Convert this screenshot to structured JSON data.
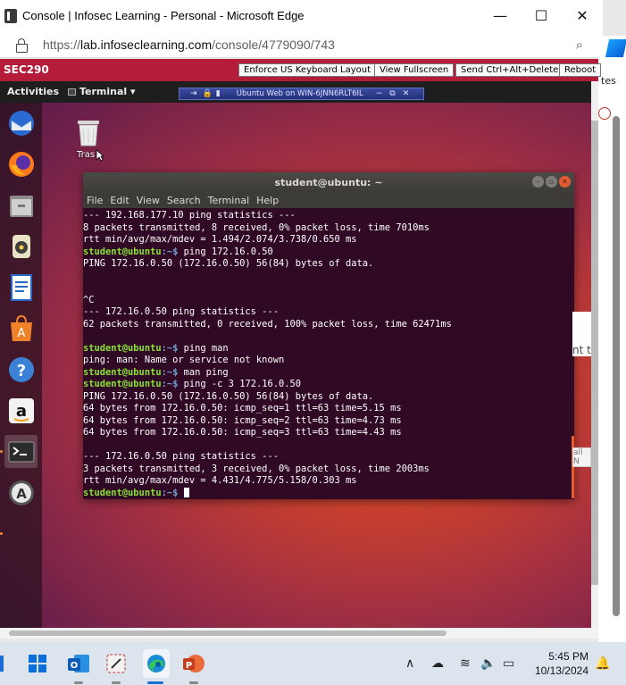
{
  "browser": {
    "title": "Console | Infosec Learning - Personal - Microsoft Edge",
    "url_prefix": "https://",
    "url_host": "lab.infoseclearning.com",
    "url_path": "/console/4779090/743",
    "minimize": "—",
    "maximize": "☐",
    "close": "✕"
  },
  "side_window": {
    "text": "tes",
    "text2": "nt t",
    "text3": "all N"
  },
  "console": {
    "label": "SEC290",
    "buttons": [
      "Enforce US Keyboard Layout",
      "View Fullscreen",
      "Send Ctrl+Alt+Delete",
      "Reboot"
    ]
  },
  "ubuntu": {
    "activities": "Activities",
    "app_menu": "Terminal ▾",
    "connection_bar": "Ubuntu Web on WIN-6JNN6RLT6IL",
    "trash_label": "Tras",
    "dock_icons": [
      "thunderbird-icon",
      "firefox-icon",
      "files-icon",
      "rhythmbox-icon",
      "libreoffice-writer-icon",
      "ubuntu-software-icon",
      "help-icon",
      "amazon-icon",
      "terminal-icon",
      "software-updater-icon"
    ]
  },
  "terminal": {
    "title": "student@ubuntu: ~",
    "menu": [
      "File",
      "Edit",
      "View",
      "Search",
      "Terminal",
      "Help"
    ],
    "prompt_user": "student@ubuntu",
    "prompt_path": ":~$",
    "lines": [
      {
        "type": "out",
        "text": "--- 192.168.177.10 ping statistics ---"
      },
      {
        "type": "out",
        "text": "8 packets transmitted, 8 received, 0% packet loss, time 7010ms"
      },
      {
        "type": "out",
        "text": "rtt min/avg/max/mdev = 1.494/2.074/3.738/0.650 ms"
      },
      {
        "type": "cmd",
        "text": " ping 172.16.0.50"
      },
      {
        "type": "out",
        "text": "PING 172.16.0.50 (172.16.0.50) 56(84) bytes of data."
      },
      {
        "type": "out",
        "text": ""
      },
      {
        "type": "out",
        "text": ""
      },
      {
        "type": "out",
        "text": "^C"
      },
      {
        "type": "out",
        "text": "--- 172.16.0.50 ping statistics ---"
      },
      {
        "type": "out",
        "text": "62 packets transmitted, 0 received, 100% packet loss, time 62471ms"
      },
      {
        "type": "out",
        "text": ""
      },
      {
        "type": "cmd",
        "text": " ping man"
      },
      {
        "type": "out",
        "text": "ping: man: Name or service not known"
      },
      {
        "type": "cmd",
        "text": " man ping"
      },
      {
        "type": "cmd",
        "text": " ping -c 3 172.16.0.50"
      },
      {
        "type": "out",
        "text": "PING 172.16.0.50 (172.16.0.50) 56(84) bytes of data."
      },
      {
        "type": "out",
        "text": "64 bytes from 172.16.0.50: icmp_seq=1 ttl=63 time=5.15 ms"
      },
      {
        "type": "out",
        "text": "64 bytes from 172.16.0.50: icmp_seq=2 ttl=63 time=4.73 ms"
      },
      {
        "type": "out",
        "text": "64 bytes from 172.16.0.50: icmp_seq=3 ttl=63 time=4.43 ms"
      },
      {
        "type": "out",
        "text": ""
      },
      {
        "type": "out",
        "text": "--- 172.16.0.50 ping statistics ---"
      },
      {
        "type": "out",
        "text": "3 packets transmitted, 3 received, 0% packet loss, time 2003ms"
      },
      {
        "type": "out",
        "text": "rtt min/avg/max/mdev = 4.431/4.775/5.158/0.303 ms"
      },
      {
        "type": "prompt",
        "text": " "
      }
    ]
  },
  "taskbar": {
    "time": "5:45 PM",
    "date": "10/13/2024",
    "apps": [
      "start-icon",
      "outlook-icon",
      "snipping-tool-icon",
      "edge-icon",
      "powerpoint-icon"
    ]
  },
  "colors": {
    "console_red": "#b51c3a",
    "terminal_bg": "#300a24",
    "prompt_green": "#8ae234",
    "path_blue": "#729fcf"
  }
}
